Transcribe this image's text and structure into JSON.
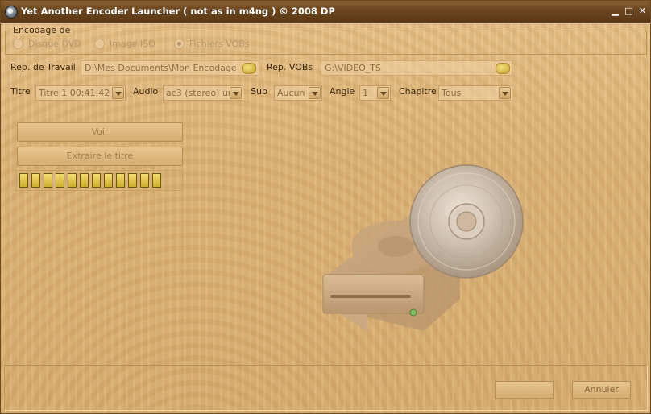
{
  "window": {
    "title": "Yet Another Encoder Launcher ( not as in m4ng )  © 2008 DP",
    "minimize": "▁",
    "maximize": "□",
    "close": "✕"
  },
  "encodage": {
    "legend": "Encodage de",
    "options": [
      {
        "label": "Disque DVD",
        "checked": false
      },
      {
        "label": "Image ISO",
        "checked": false
      },
      {
        "label": "Fichiers VOBs",
        "checked": true
      }
    ]
  },
  "paths": {
    "travail_label": "Rep. de Travail",
    "travail_value": "D:\\Mes Documents\\Mon Encodage",
    "vobs_label": "Rep. VOBs",
    "vobs_value": "G:\\VIDEO_TS"
  },
  "selectors": {
    "titre_label": "Titre",
    "titre_value": "Titre  1  00:41:42",
    "audio_label": "Audio",
    "audio_value": "ac3 (stereo) unk",
    "sub_label": "Sub",
    "sub_value": "Aucun",
    "angle_label": "Angle",
    "angle_value": "1",
    "chapitre_label": "Chapitre",
    "chapitre_value": "Tous"
  },
  "actions": {
    "voir": "Voir",
    "extraire": "Extraire le titre"
  },
  "progress": {
    "filled_segments": 12,
    "total_segments": 12
  },
  "footer": {
    "ok_label": "",
    "annuler_label": "Annuler"
  },
  "icons": {
    "app": "dvd-disc-icon",
    "folder": "folder-icon",
    "illustration": "drive-with-disc-icon"
  }
}
